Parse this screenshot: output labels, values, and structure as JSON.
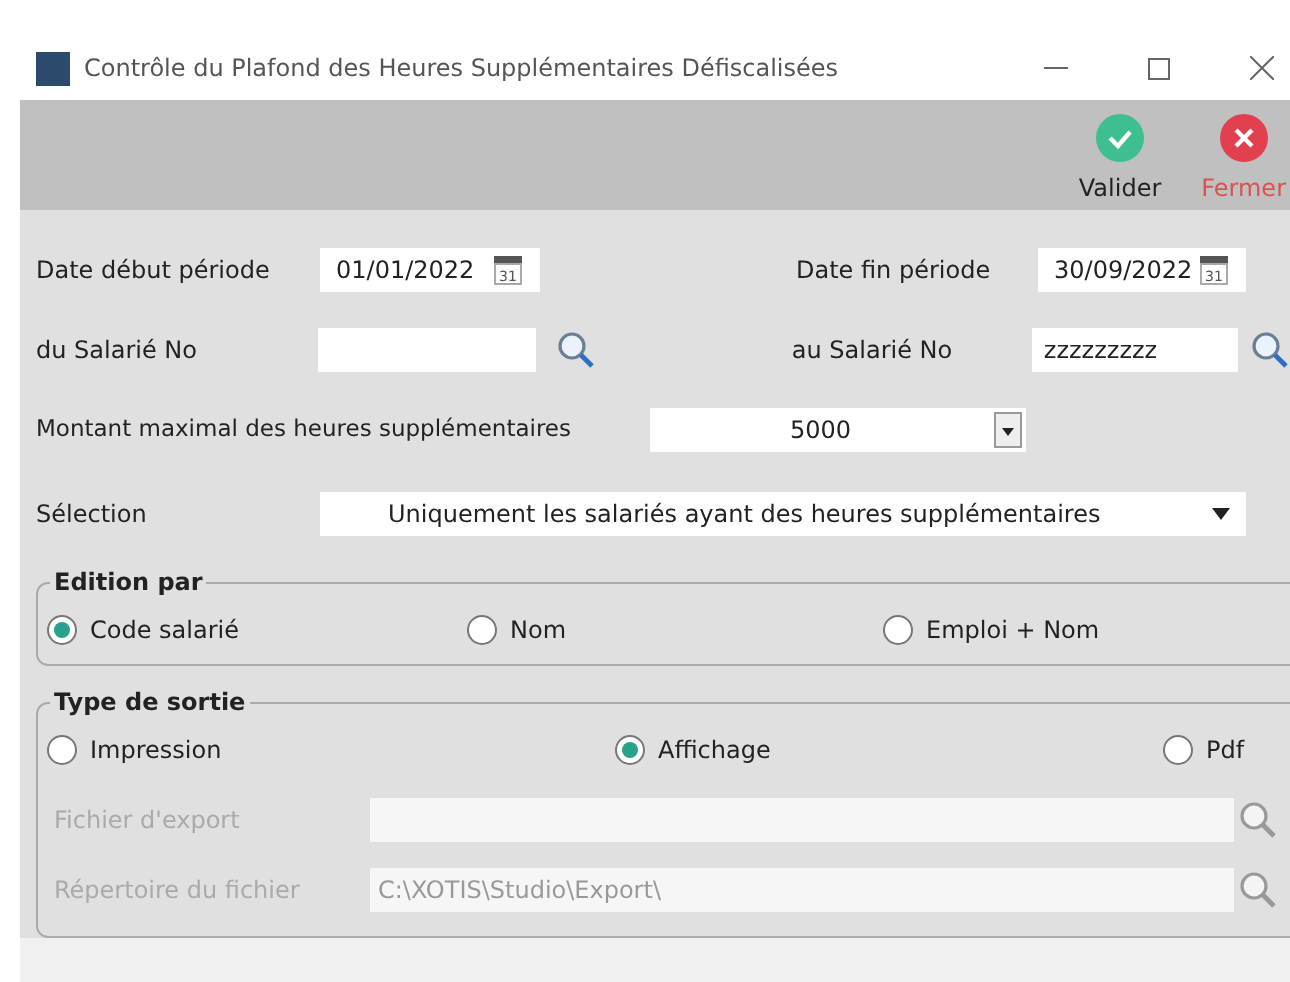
{
  "window": {
    "title": "Contrôle du Plafond des Heures Supplémentaires Défiscalisées"
  },
  "toolbar": [
    {
      "kind": "validate",
      "label": "Valider"
    },
    {
      "kind": "close",
      "label": "Fermer"
    }
  ],
  "date_row": [
    {
      "label": "Date début période",
      "value": "01/01/2022",
      "icon_text": "31"
    },
    {
      "label": "Date fin période",
      "value": "30/09/2022",
      "icon_text": "31"
    }
  ],
  "employee_row": [
    {
      "label": "du Salarié No"
    },
    {
      "label": "au Salarié No",
      "value": "zzzzzzzzz"
    }
  ],
  "max_amount": {
    "label": "Montant maximal des heures supplémentaires",
    "value": "5000"
  },
  "selection": {
    "label": "Sélection",
    "value": "Uniquement les salariés ayant des heures supplémentaires"
  },
  "edition_par": {
    "title": "Edition par",
    "options": [
      {
        "label": "Code salarié",
        "selected": true
      },
      {
        "label": "Nom",
        "selected": false
      },
      {
        "label": "Emploi + Nom",
        "selected": false
      }
    ]
  },
  "type_de_sortie": {
    "title": "Type de sortie",
    "options": [
      {
        "label": "Impression",
        "selected": false
      },
      {
        "label": "Affichage",
        "selected": true
      },
      {
        "label": "Pdf",
        "selected": false
      }
    ],
    "files": [
      {
        "label": "Fichier d'export",
        "disabled": true
      },
      {
        "label": "Répertoire du fichier",
        "value": "C:\\XOTIS\\Studio\\Export\\",
        "disabled": true
      }
    ]
  }
}
